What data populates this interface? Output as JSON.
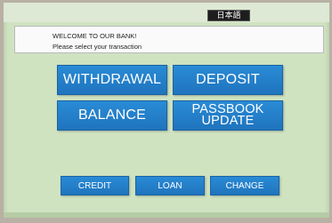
{
  "language_button": {
    "label": "日本語"
  },
  "message": {
    "line1": "WELCOME TO OUR BANK!",
    "line2": "Please select your transaction"
  },
  "transactions": {
    "withdrawal": "WITHDRAWAL",
    "deposit": "DEPOSIT",
    "balance": "BALANCE",
    "passbook_line1": "PASSBOOK",
    "passbook_line2": "UPDATE"
  },
  "secondary": {
    "credit": "CREDIT",
    "loan": "LOAN",
    "change": "CHANGE"
  },
  "colors": {
    "screen_background": "#cfe3c1",
    "button_blue": "#1f74bd"
  }
}
